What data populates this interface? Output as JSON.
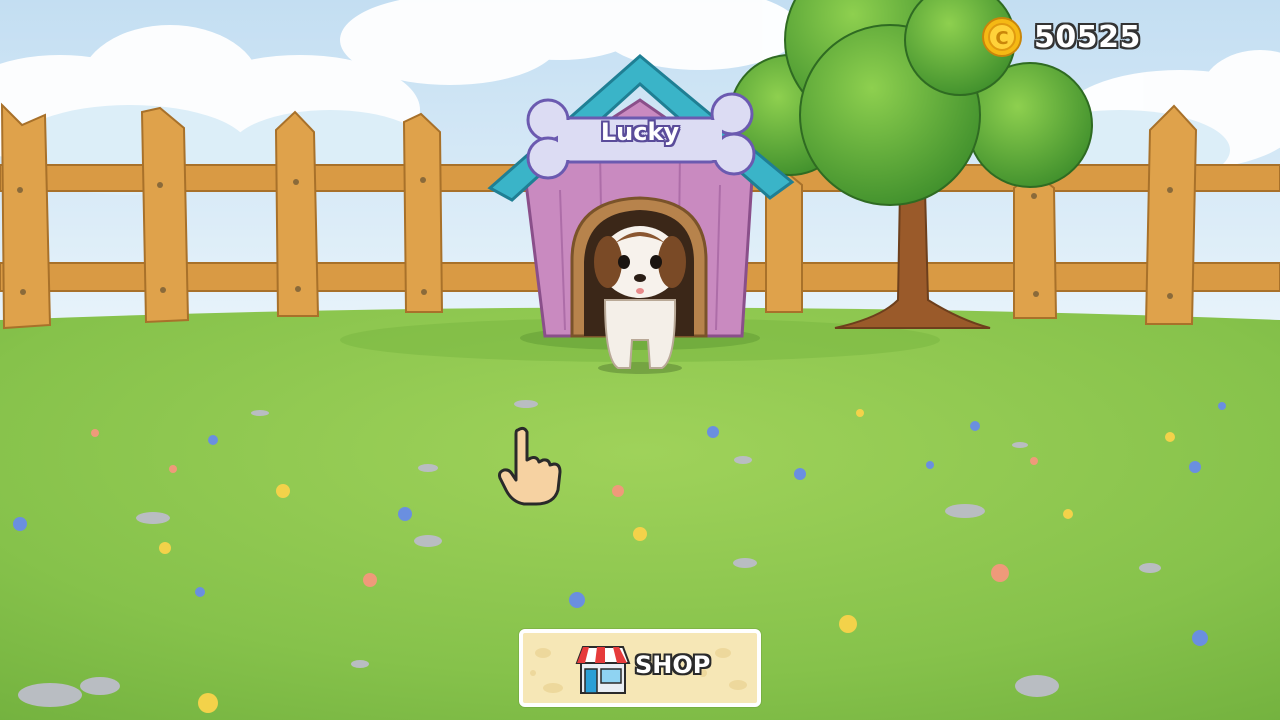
{
  "hud": {
    "coins": "50525",
    "coin_icon": "coin-icon",
    "coin_color": "#f5b914"
  },
  "pet": {
    "name": "Lucky"
  },
  "shop": {
    "label": "SHOP",
    "icon": "shop-store-icon"
  },
  "cursor": {
    "icon": "pointing-hand-icon"
  },
  "colors": {
    "sky": "#d6ecf8",
    "grass": "#8cc64a",
    "fence": "#d79a45",
    "doghouse_roof": "#3ab4c8",
    "doghouse_wall": "#c98ac0"
  }
}
